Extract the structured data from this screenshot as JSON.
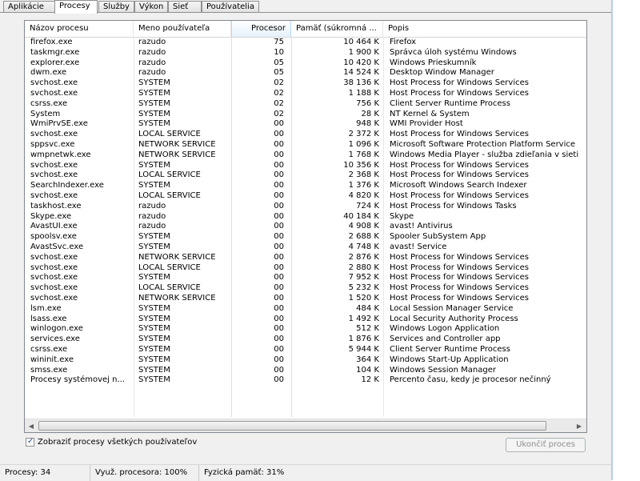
{
  "tabs": [
    {
      "label": "Aplikácie",
      "active": false
    },
    {
      "label": "Procesy",
      "active": true
    },
    {
      "label": "Služby",
      "active": false
    },
    {
      "label": "Výkon",
      "active": false
    },
    {
      "label": "Sieť",
      "active": false
    },
    {
      "label": "Používatelia",
      "active": false
    }
  ],
  "columns": {
    "name": "Názov procesu",
    "user": "Meno používateľa",
    "cpu": "Procesor",
    "memory": "Pamäť (súkromná ...",
    "description": "Popis"
  },
  "processes": [
    {
      "name": "firefox.exe",
      "user": "razudo",
      "cpu": "75",
      "memory": "10 464 K",
      "description": "Firefox"
    },
    {
      "name": "taskmgr.exe",
      "user": "razudo",
      "cpu": "10",
      "memory": "1 900 K",
      "description": "Správca úloh systému Windows"
    },
    {
      "name": "explorer.exe",
      "user": "razudo",
      "cpu": "05",
      "memory": "10 420 K",
      "description": "Windows Prieskumník"
    },
    {
      "name": "dwm.exe",
      "user": "razudo",
      "cpu": "05",
      "memory": "14 524 K",
      "description": "Desktop Window Manager"
    },
    {
      "name": "svchost.exe",
      "user": "SYSTEM",
      "cpu": "02",
      "memory": "38 136 K",
      "description": "Host Process for Windows Services"
    },
    {
      "name": "svchost.exe",
      "user": "SYSTEM",
      "cpu": "02",
      "memory": "1 188 K",
      "description": "Host Process for Windows Services"
    },
    {
      "name": "csrss.exe",
      "user": "SYSTEM",
      "cpu": "02",
      "memory": "756 K",
      "description": "Client Server Runtime Process"
    },
    {
      "name": "System",
      "user": "SYSTEM",
      "cpu": "02",
      "memory": "28 K",
      "description": "NT Kernel & System"
    },
    {
      "name": "WmiPrvSE.exe",
      "user": "SYSTEM",
      "cpu": "00",
      "memory": "948 K",
      "description": "WMI Provider Host"
    },
    {
      "name": "svchost.exe",
      "user": "LOCAL SERVICE",
      "cpu": "00",
      "memory": "2 372 K",
      "description": "Host Process for Windows Services"
    },
    {
      "name": "sppsvc.exe",
      "user": "NETWORK SERVICE",
      "cpu": "00",
      "memory": "1 096 K",
      "description": "Microsoft Software Protection Platform Service"
    },
    {
      "name": "wmpnetwk.exe",
      "user": "NETWORK SERVICE",
      "cpu": "00",
      "memory": "1 768 K",
      "description": "Windows Media Player - služba zdieľania v sieti"
    },
    {
      "name": "svchost.exe",
      "user": "SYSTEM",
      "cpu": "00",
      "memory": "10 356 K",
      "description": "Host Process for Windows Services"
    },
    {
      "name": "svchost.exe",
      "user": "LOCAL SERVICE",
      "cpu": "00",
      "memory": "2 368 K",
      "description": "Host Process for Windows Services"
    },
    {
      "name": "SearchIndexer.exe",
      "user": "SYSTEM",
      "cpu": "00",
      "memory": "1 376 K",
      "description": "Microsoft Windows Search Indexer"
    },
    {
      "name": "svchost.exe",
      "user": "LOCAL SERVICE",
      "cpu": "00",
      "memory": "4 820 K",
      "description": "Host Process for Windows Services"
    },
    {
      "name": "taskhost.exe",
      "user": "razudo",
      "cpu": "00",
      "memory": "724 K",
      "description": "Host Process for Windows Tasks"
    },
    {
      "name": "Skype.exe",
      "user": "razudo",
      "cpu": "00",
      "memory": "40 184 K",
      "description": "Skype"
    },
    {
      "name": "AvastUI.exe",
      "user": "razudo",
      "cpu": "00",
      "memory": "4 908 K",
      "description": "avast! Antivirus"
    },
    {
      "name": "spoolsv.exe",
      "user": "SYSTEM",
      "cpu": "00",
      "memory": "2 688 K",
      "description": "Spooler SubSystem App"
    },
    {
      "name": "AvastSvc.exe",
      "user": "SYSTEM",
      "cpu": "00",
      "memory": "4 748 K",
      "description": "avast! Service"
    },
    {
      "name": "svchost.exe",
      "user": "NETWORK SERVICE",
      "cpu": "00",
      "memory": "2 876 K",
      "description": "Host Process for Windows Services"
    },
    {
      "name": "svchost.exe",
      "user": "LOCAL SERVICE",
      "cpu": "00",
      "memory": "2 880 K",
      "description": "Host Process for Windows Services"
    },
    {
      "name": "svchost.exe",
      "user": "SYSTEM",
      "cpu": "00",
      "memory": "7 952 K",
      "description": "Host Process for Windows Services"
    },
    {
      "name": "svchost.exe",
      "user": "LOCAL SERVICE",
      "cpu": "00",
      "memory": "5 232 K",
      "description": "Host Process for Windows Services"
    },
    {
      "name": "svchost.exe",
      "user": "NETWORK SERVICE",
      "cpu": "00",
      "memory": "1 520 K",
      "description": "Host Process for Windows Services"
    },
    {
      "name": "lsm.exe",
      "user": "SYSTEM",
      "cpu": "00",
      "memory": "484 K",
      "description": "Local Session Manager Service"
    },
    {
      "name": "lsass.exe",
      "user": "SYSTEM",
      "cpu": "00",
      "memory": "1 492 K",
      "description": "Local Security Authority Process"
    },
    {
      "name": "winlogon.exe",
      "user": "SYSTEM",
      "cpu": "00",
      "memory": "512 K",
      "description": "Windows Logon Application"
    },
    {
      "name": "services.exe",
      "user": "SYSTEM",
      "cpu": "00",
      "memory": "1 876 K",
      "description": "Services and Controller app"
    },
    {
      "name": "csrss.exe",
      "user": "SYSTEM",
      "cpu": "00",
      "memory": "5 944 K",
      "description": "Client Server Runtime Process"
    },
    {
      "name": "wininit.exe",
      "user": "SYSTEM",
      "cpu": "00",
      "memory": "364 K",
      "description": "Windows Start-Up Application"
    },
    {
      "name": "smss.exe",
      "user": "SYSTEM",
      "cpu": "00",
      "memory": "104 K",
      "description": "Windows Session Manager"
    },
    {
      "name": "Procesy systémovej n...",
      "user": "SYSTEM",
      "cpu": "00",
      "memory": "12 K",
      "description": "Percento času, kedy je procesor nečinný"
    }
  ],
  "show_all_users": {
    "label": "Zobraziť procesy všetkých používateľov",
    "checked": true
  },
  "end_process_button": {
    "label": "Ukončiť proces",
    "enabled": false
  },
  "status": {
    "processes": "Procesy: 34",
    "cpu_usage": "Využ. procesora: 100%",
    "physical_memory": "Fyzická pamäť: 31%"
  },
  "icons": {
    "scroll_left": "chevron-left-icon",
    "scroll_right": "chevron-right-icon",
    "checkbox": "check-icon"
  }
}
